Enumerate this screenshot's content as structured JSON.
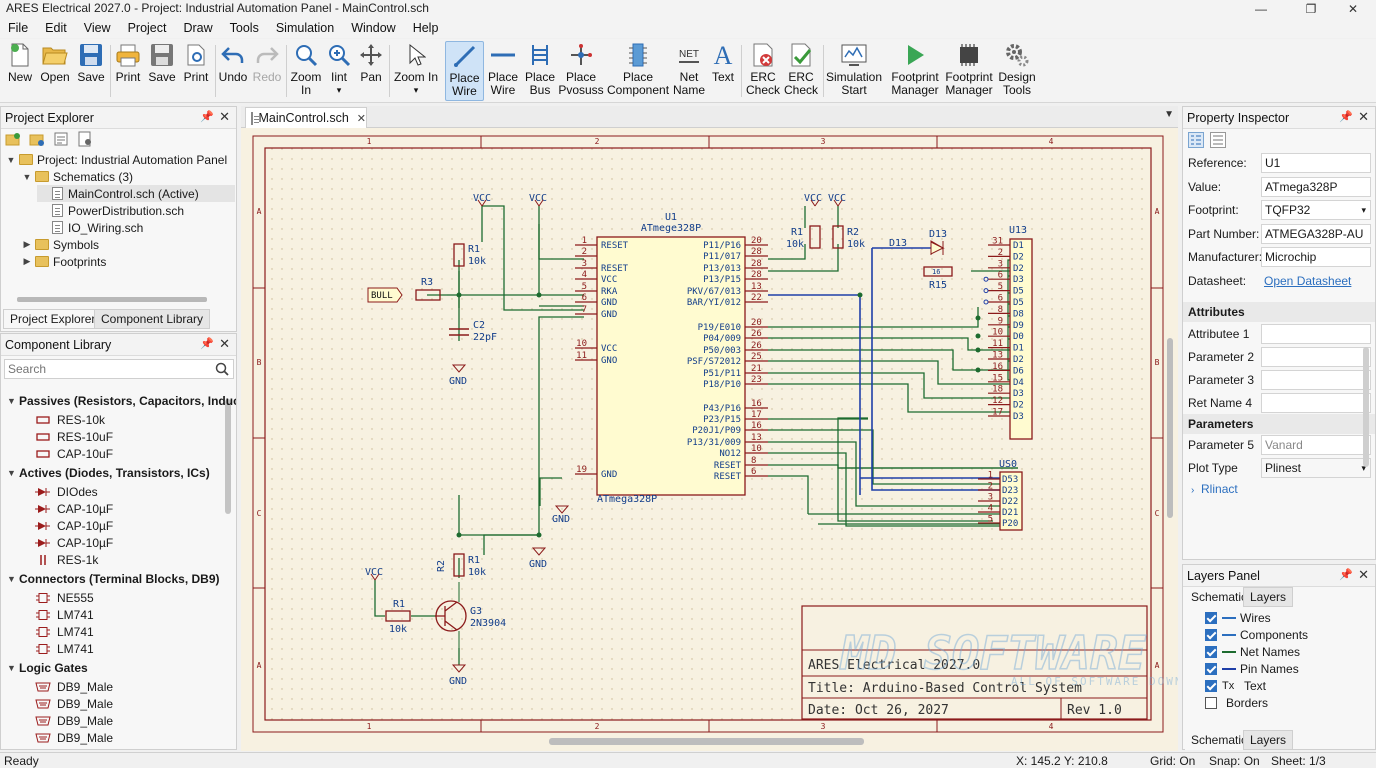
{
  "app": {
    "window_title": "ARES Electrical 2027.0 - Project: Industrial Automation Panel - MainControl.sch",
    "win_min": "—",
    "win_restore": "❐",
    "win_close": "✕"
  },
  "menu": [
    "File",
    "Edit",
    "View",
    "Project",
    "Draw",
    "Tools",
    "Simulation",
    "Window",
    "Help"
  ],
  "toolbar": {
    "new": "New",
    "open": "Open",
    "save": "Save",
    "print": "Print",
    "save2": "Save",
    "print2": "Print",
    "undo": "Undo",
    "redo": "Redo",
    "zoom_in_1": "Zoom",
    "zoom_in_2": "In",
    "zoom_lint_1": "Iint",
    "zoom_lint_2": "▾",
    "pan": "Pan",
    "zoom_in_dd": "Zoom In",
    "zoom_in_dd_arrow": "▾",
    "place_wire_1": "Place",
    "place_wire_2": "Wire",
    "place_wire2_1": "Place",
    "place_wire2_2": "Wire",
    "place_bus_1": "Place",
    "place_bus_2": "Bus",
    "place_pvosuss_1": "Place",
    "place_pvosuss_2": "Pvosuss",
    "place_component_1": "Place",
    "place_component_2": "Component",
    "net_name_1": "Net",
    "net_name_2": "Name",
    "net_icon": "NET",
    "text": "Text",
    "text_icon": "A",
    "erc_check_1": "ERC",
    "erc_check_2": "Check",
    "erc_check2_1": "ERC",
    "erc_check2_2": "Check",
    "sim_start_1": "Simulation",
    "sim_start_2": "Start",
    "fp_manager_1": "Footprint",
    "fp_manager_2": "Manager",
    "fp_manager2_1": "Footprint",
    "fp_manager2_2": "Manager",
    "design_tools_1": "Design",
    "design_tools_2": "Tools"
  },
  "project_explorer": {
    "title": "Project Explorer",
    "root": "Project: Industrial Automation Panel",
    "schematics": "Schematics (3)",
    "files": [
      "MainControl.sch (Active)",
      "PowerDistribution.sch",
      "IO_Wiring.sch"
    ],
    "symbols": "Symbols",
    "footprints": "Footprints",
    "tab_explorer": "Project Explorer",
    "tab_library": "Component Library"
  },
  "component_library": {
    "title": "Component Library",
    "search_placeholder": "Search",
    "categories": [
      {
        "name": "Passives (Resistors, Capacitors, Inducto",
        "items": [
          "RES-10k",
          "RES-10uF",
          "CAP-10uF"
        ]
      },
      {
        "name": "Actives (Diodes, Transistors, ICs)",
        "items": [
          "DIOdes",
          "CAP-10µF",
          "CAP-10µF",
          "CAP-10µF",
          "RES-1k"
        ]
      },
      {
        "name": "Connectors (Terminal Blocks, DB9)",
        "items": [
          "NE555",
          "LM741",
          "LM741",
          "LM741"
        ]
      },
      {
        "name": "Logic Gates",
        "items": [
          "DB9_Male",
          "DB9_Male",
          "DB9_Male",
          "DB9_Male"
        ]
      }
    ]
  },
  "document": {
    "tab": "MainControl.sch",
    "tab_close": "✕",
    "col_labels": [
      "1",
      "2",
      "3",
      "4"
    ],
    "row_labels": [
      "A",
      "B",
      "C",
      "A"
    ]
  },
  "schematic": {
    "u1_ref": "U1",
    "u1_val": "ATmege328P",
    "u1_bottom": "ATmega328P",
    "u1_left_pins": [
      {
        "num": "1",
        "name": "RESET"
      },
      {
        "num": "2",
        "name": ""
      },
      {
        "num": "3",
        "name": "RESET"
      },
      {
        "num": "4",
        "name": "VCC"
      },
      {
        "num": "5",
        "name": "RKA"
      },
      {
        "num": "6",
        "name": "GND"
      },
      {
        "num": "7",
        "name": "GND"
      },
      {
        "num": "10",
        "name": "VCC"
      },
      {
        "num": "11",
        "name": "GNO"
      },
      {
        "num": "19",
        "name": "GND"
      }
    ],
    "u1_right_pins": [
      {
        "num": "20",
        "name": "P11/P16"
      },
      {
        "num": "28",
        "name": "P11/017"
      },
      {
        "num": "28",
        "name": "P13/013"
      },
      {
        "num": "28",
        "name": "P13/P15"
      },
      {
        "num": "13",
        "name": "PKV/67/013"
      },
      {
        "num": "22",
        "name": "BAR/YI/012"
      },
      {
        "num": "20",
        "name": "P19/E010"
      },
      {
        "num": "26",
        "name": "P04/009"
      },
      {
        "num": "26",
        "name": "P50/003"
      },
      {
        "num": "25",
        "name": "PSF/S72012"
      },
      {
        "num": "21",
        "name": "P51/P11"
      },
      {
        "num": "23",
        "name": "P18/P10"
      },
      {
        "num": "16",
        "name": "P43/P16"
      },
      {
        "num": "17",
        "name": "P23/P15"
      },
      {
        "num": "16",
        "name": "P20J1/P09"
      },
      {
        "num": "13",
        "name": "P13/31/009"
      },
      {
        "num": "10",
        "name": "NO12"
      },
      {
        "num": "8",
        "name": "RESET"
      },
      {
        "num": "6",
        "name": "RESET"
      }
    ],
    "u13_ref": "U13",
    "u13_pins": [
      {
        "num": "31",
        "name": "D1"
      },
      {
        "num": "2",
        "name": "D2"
      },
      {
        "num": "3",
        "name": "D2"
      },
      {
        "num": "6",
        "name": "D3"
      },
      {
        "num": "5",
        "name": "D5"
      },
      {
        "num": "6",
        "name": "D5"
      },
      {
        "num": "8",
        "name": "D8"
      },
      {
        "num": "9",
        "name": "D9"
      },
      {
        "num": "10",
        "name": "D0"
      },
      {
        "num": "11",
        "name": "D1"
      },
      {
        "num": "13",
        "name": "D2"
      },
      {
        "num": "16",
        "name": "D6"
      },
      {
        "num": "15",
        "name": "D4"
      },
      {
        "num": "18",
        "name": "D3"
      },
      {
        "num": "12",
        "name": "D2"
      },
      {
        "num": "17",
        "name": "D3"
      }
    ],
    "us0_ref": "US0",
    "us0_pins": [
      {
        "num": "1",
        "name": "D53"
      },
      {
        "num": "2",
        "name": "D23"
      },
      {
        "num": "3",
        "name": "D22"
      },
      {
        "num": "4",
        "name": "D21"
      },
      {
        "num": "5",
        "name": "P20"
      }
    ],
    "vcc": "VCC",
    "gnd": "GND",
    "r1_ref": "R1",
    "r1_val": "10k",
    "r1b_ref": "R1",
    "r1b_val": "10k",
    "r2_ref": "R2",
    "r2_val": "10k",
    "r3_ref": "R3",
    "c2_ref": "C2",
    "c2_val": "22pF",
    "bull": "BULL",
    "d13_ref": "D13",
    "d13_net": "D13",
    "r15_ref": "R15",
    "r15_body": "16",
    "r2v_ref": "R2",
    "r1c_ref": "R1",
    "r1c_val": "10k",
    "r1d_ref": "R1",
    "r1d_val": "10k",
    "q_ref": "G3",
    "q_val": "2N3904"
  },
  "title_block": {
    "company": "ARES Electrical 2027.0",
    "title": "Title: Arduino-Based Control System",
    "date": "Date: Oct 26, 2027",
    "rev": "Rev 1.0"
  },
  "watermark": {
    "main": "MD SOFTWARE",
    "sub": "ALL OF SOFTWARE DOWNLOADS"
  },
  "property_inspector": {
    "title": "Property Inspector",
    "fields": [
      {
        "label": "Reference:",
        "value": "U1"
      },
      {
        "label": "Value:",
        "value": "ATmega328P"
      },
      {
        "label": "Footprint:",
        "value": "TQFP32"
      },
      {
        "label": "Part Number:",
        "value": "ATMEGA328P-AU"
      },
      {
        "label": "Manufacturer:",
        "value": "Microchip"
      },
      {
        "label": "Datasheet:",
        "value": "Open Datasheet"
      }
    ],
    "attributes_header": "Attributes",
    "attributes": [
      "Attributee 1",
      "Parameter 2",
      "Parameter 3",
      "Ret Name 4"
    ],
    "parameters_header": "Parameters",
    "param5_label": "Parameter 5",
    "param5_value": "Vanard",
    "plot_type_label": "Plot Type",
    "plot_type_value": "Plinest",
    "rlinact": "Rlinact"
  },
  "layers_panel": {
    "title": "Layers Panel",
    "tab_schematic": "Schematic",
    "tab_layers": "Layers",
    "layers": [
      {
        "name": "Wires",
        "on": true
      },
      {
        "name": "Components",
        "on": true
      },
      {
        "name": "Net Names",
        "on": true
      },
      {
        "name": "Pin Names",
        "on": true
      },
      {
        "name": "Text",
        "on": true
      },
      {
        "name": "Borders",
        "on": false
      }
    ],
    "bottom_tab_schematic": "Schematic",
    "bottom_tab_layers": "Layers"
  },
  "status": {
    "ready": "Ready",
    "coords": "X: 145.2  Y: 210.8",
    "grid": "Grid: On",
    "snap": "Snap: On",
    "sheet": "Sheet: 1/3"
  },
  "colors": {
    "accent": "#2c6fbf",
    "wire": "#1d6b2f",
    "bus": "#1f3fa8",
    "component": "#8b1a1a",
    "sheet_bg": "#f7f1e1"
  }
}
